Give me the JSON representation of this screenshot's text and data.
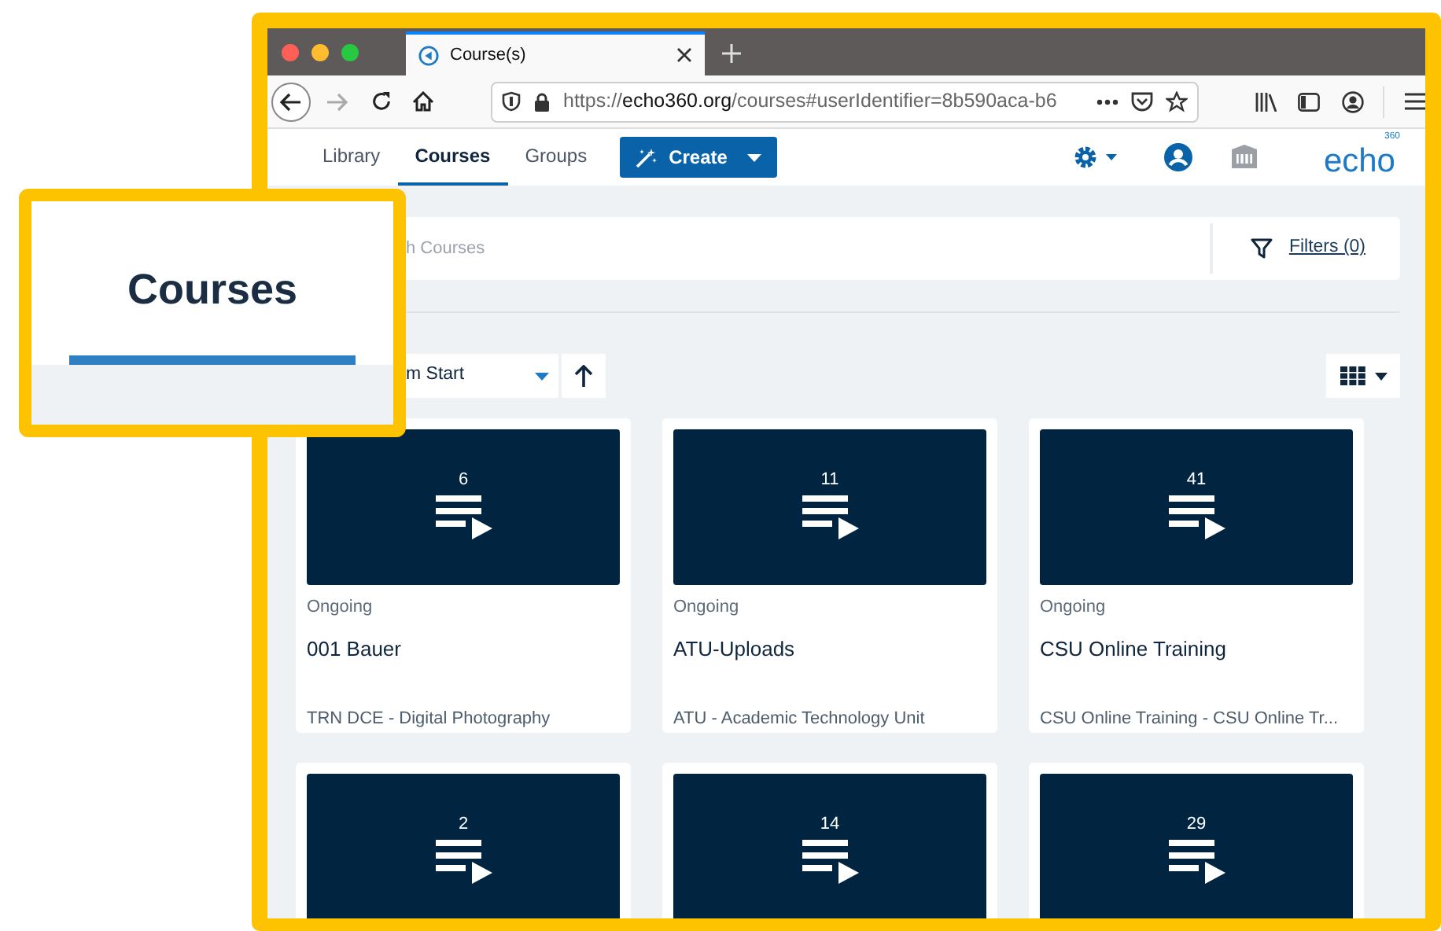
{
  "browser": {
    "tab_title": "Course(s)",
    "url": "https://**echo360.org**/courses#userIdentifier=8b590aca-b6"
  },
  "nav": {
    "items": [
      {
        "label": "Library",
        "selected": false
      },
      {
        "label": "Courses",
        "selected": true
      },
      {
        "label": "Groups",
        "selected": false
      }
    ],
    "create_button": "Create",
    "logo": "echo",
    "logo_mark": "360"
  },
  "search": {
    "placeholder": "h Courses"
  },
  "filters_link": "Filters (0)",
  "sort": {
    "value": "m Start"
  },
  "courses": [
    {
      "count": "6",
      "status": "Ongoing",
      "title": "001 Bauer",
      "subtitle": "TRN DCE - Digital Photography"
    },
    {
      "count": "11",
      "status": "Ongoing",
      "title": "ATU-Uploads",
      "subtitle": "ATU - Academic Technology Unit"
    },
    {
      "count": "41",
      "status": "Ongoing",
      "title": "CSU Online Training",
      "subtitle": "CSU Online Training - CSU Online Tr..."
    },
    {
      "count": "2"
    },
    {
      "count": "14"
    },
    {
      "count": "29"
    }
  ],
  "callout": {
    "label": "Courses"
  }
}
